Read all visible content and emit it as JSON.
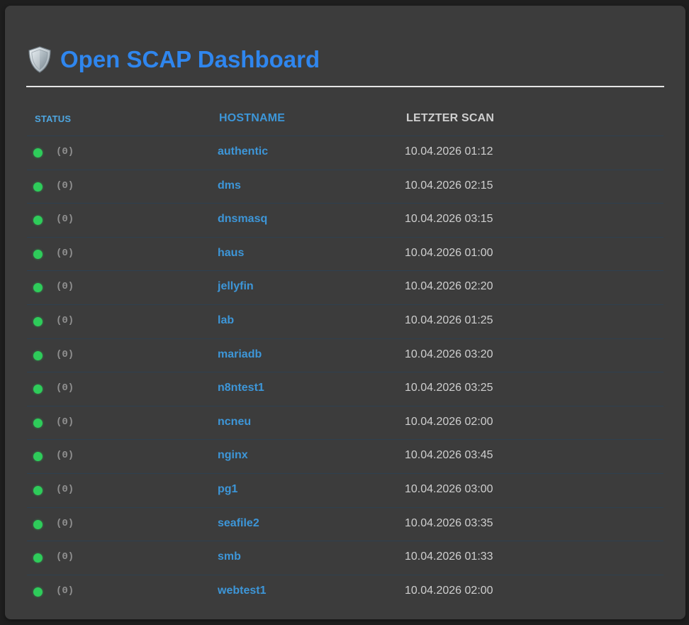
{
  "header": {
    "icon": "shield-icon",
    "title": "Open SCAP Dashboard"
  },
  "table": {
    "columns": [
      "STATUS",
      "HOSTNAME",
      "LETZTER SCAN"
    ],
    "rows": [
      {
        "status": "ok",
        "count": "(0)",
        "hostname": "authentic",
        "last_scan": "10.04.2026 01:12"
      },
      {
        "status": "ok",
        "count": "(0)",
        "hostname": "dms",
        "last_scan": "10.04.2026 02:15"
      },
      {
        "status": "ok",
        "count": "(0)",
        "hostname": "dnsmasq",
        "last_scan": "10.04.2026 03:15"
      },
      {
        "status": "ok",
        "count": "(0)",
        "hostname": "haus",
        "last_scan": "10.04.2026 01:00"
      },
      {
        "status": "ok",
        "count": "(0)",
        "hostname": "jellyfin",
        "last_scan": "10.04.2026 02:20"
      },
      {
        "status": "ok",
        "count": "(0)",
        "hostname": "lab",
        "last_scan": "10.04.2026 01:25"
      },
      {
        "status": "ok",
        "count": "(0)",
        "hostname": "mariadb",
        "last_scan": "10.04.2026 03:20"
      },
      {
        "status": "ok",
        "count": "(0)",
        "hostname": "n8ntest1",
        "last_scan": "10.04.2026 03:25"
      },
      {
        "status": "ok",
        "count": "(0)",
        "hostname": "ncneu",
        "last_scan": "10.04.2026 02:00"
      },
      {
        "status": "ok",
        "count": "(0)",
        "hostname": "nginx",
        "last_scan": "10.04.2026 03:45"
      },
      {
        "status": "ok",
        "count": "(0)",
        "hostname": "pg1",
        "last_scan": "10.04.2026 03:00"
      },
      {
        "status": "ok",
        "count": "(0)",
        "hostname": "seafile2",
        "last_scan": "10.04.2026 03:35"
      },
      {
        "status": "ok",
        "count": "(0)",
        "hostname": "smb",
        "last_scan": "10.04.2026 01:33"
      },
      {
        "status": "ok",
        "count": "(0)",
        "hostname": "webtest1",
        "last_scan": "10.04.2026 02:00"
      }
    ]
  },
  "colors": {
    "accent": "#2f86ee",
    "link": "#3d96d8",
    "status_ok": "#2ecc5a",
    "panel": "#3c3c3c",
    "background": "#1e1e1e"
  }
}
